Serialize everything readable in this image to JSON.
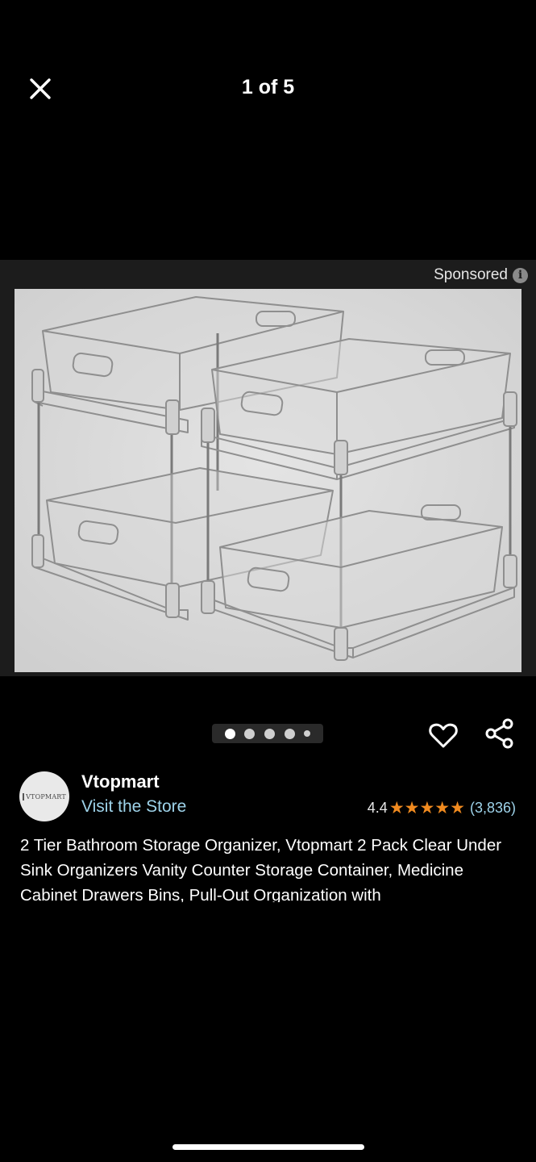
{
  "header": {
    "counter": "1 of 5",
    "close_icon": "close-icon"
  },
  "sponsored": {
    "label": "Sponsored",
    "info_icon": "i"
  },
  "gallery": {
    "total_images": 5,
    "current_index": 1
  },
  "product": {
    "brand_logo_text": "VTOPMART",
    "brand": "Vtopmart",
    "visit_store": "Visit the Store",
    "rating": "4.4",
    "stars": 4.4,
    "rating_count": "(3,836)",
    "title": "2 Tier Bathroom Storage Organizer, Vtopmart 2 Pack Clear Under Sink Organizers Vanity Counter Storage Container, Medicine Cabinet Drawers Bins, Pull-Out Organization with"
  },
  "colors": {
    "star": "#f08a1f",
    "link": "#9ed3ea",
    "background": "#000000"
  }
}
